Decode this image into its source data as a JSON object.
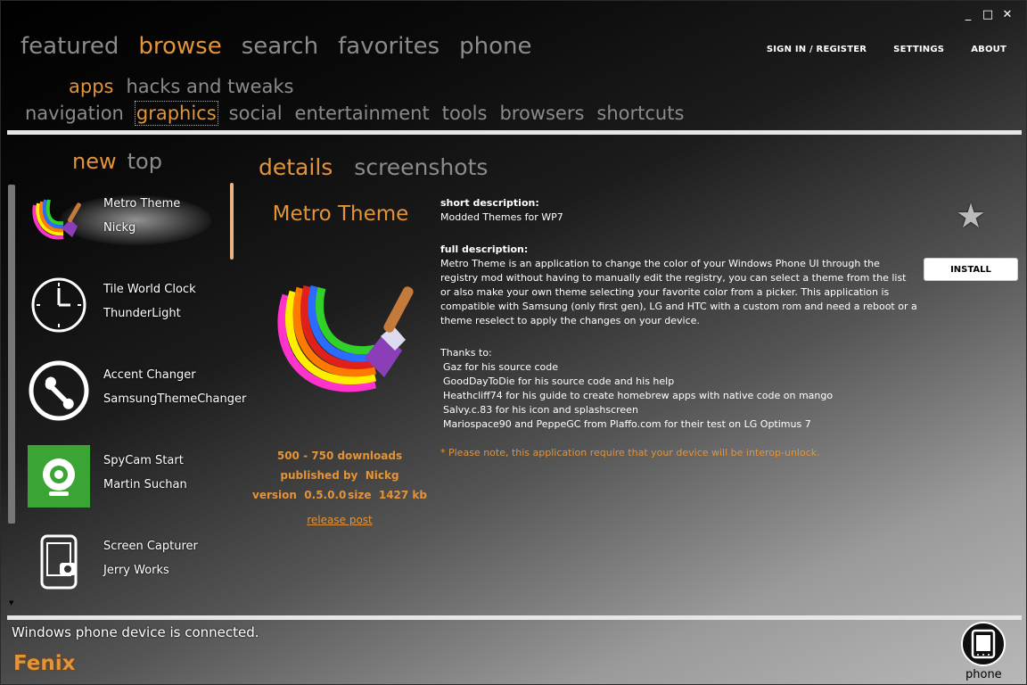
{
  "window": {
    "controls": [
      "_",
      "□",
      "✕"
    ]
  },
  "nav": {
    "main": [
      "featured",
      "browse",
      "search",
      "favorites",
      "phone"
    ],
    "sub": [
      "apps",
      "hacks and tweaks"
    ],
    "categories": [
      "navigation",
      "graphics",
      "social",
      "entertainment",
      "tools",
      "browsers",
      "shortcuts"
    ],
    "top_links": {
      "signin": "SIGN IN / REGISTER",
      "settings": "SETTINGS",
      "about": "ABOUT"
    }
  },
  "list": {
    "tabs": [
      "new",
      "top"
    ],
    "apps": [
      {
        "name": "Metro Theme",
        "author": "Nickg",
        "icon": "paintbrush-rainbow-icon"
      },
      {
        "name": "Tile World Clock",
        "author": "ThunderLight",
        "icon": "clock-icon"
      },
      {
        "name": "Accent Changer",
        "author": "SamsungThemeChanger",
        "icon": "wrench-icon"
      },
      {
        "name": "SpyCam Start",
        "author": "Martin Suchan",
        "icon": "webcam-icon"
      },
      {
        "name": "Screen Capturer",
        "author": "Jerry Works",
        "icon": "phone-camera-icon"
      }
    ]
  },
  "details": {
    "tabs": [
      "details",
      "screenshots"
    ],
    "app_title": "Metro Theme",
    "downloads": "500 - 750 downloads",
    "published_label": "published by",
    "publisher": "Nickg",
    "version_label": "version",
    "version": "0.5.0.0",
    "size_label": "size",
    "size": "1427 kb",
    "release_link": "release post",
    "short_desc_heading": "short description:",
    "short_desc": "Modded Themes for WP7",
    "full_desc_heading": "full description:",
    "full_desc": "Metro Theme is an application to change the color of your Windows Phone UI through the registry mod without having to manually edit the registry, you can select a theme from the list or also make your own theme selecting your favorite color from a picker. This application is compatible with Samsung (only first gen), LG and HTC with a custom rom and need a reboot or a theme reselect to apply the changes on your device.",
    "thanks_heading": "Thanks to:",
    "thanks": [
      "Gaz for his source code",
      "GoodDayToDie for his source code and his help",
      "Heathcliff74 for his guide to create homebrew apps with native code on mango",
      "Salvy.c.83 for his icon and splashscreen",
      "Mariospace90 and PeppeGC from Plaffo.com for their test on LG Optimus 7"
    ],
    "note": "* Please note, this application require that your device will be interop-unlock.",
    "install_label": "INSTALL"
  },
  "status": {
    "message": "Windows phone device is connected.",
    "brand": "Fenix",
    "phone_label": "phone"
  },
  "colors": {
    "accent": "#e39338",
    "inactive": "#8b8b8b"
  }
}
